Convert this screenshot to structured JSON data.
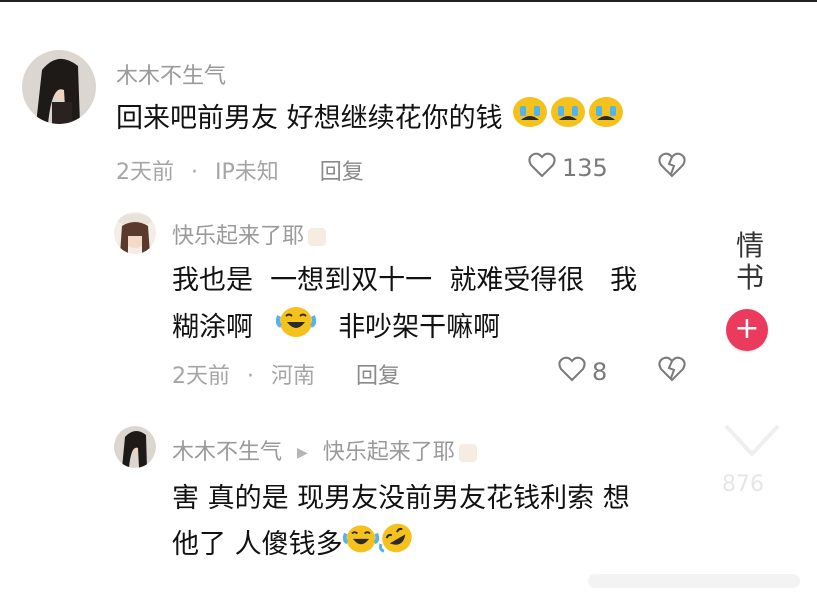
{
  "comments": [
    {
      "username": "木木不生气",
      "text": "回来吧前男友 好想继续花你的钱",
      "time": "2天前",
      "location": "IP未知",
      "reply_label": "回复",
      "likes": "135"
    },
    {
      "username": "快乐起来了耶",
      "text_line1": "我也是  一想到双十一  就难受得很   我",
      "text_line2a": "糊涂啊",
      "text_line2b": "非吵架干嘛啊",
      "time": "2天前",
      "location": "河南",
      "reply_label": "回复",
      "likes": "8"
    },
    {
      "username": "木木不生气",
      "reply_to": "快乐起来了耶",
      "text_line1": "害 真的是 现男友没前男友花钱利索 想",
      "text_line2": "他了 人傻钱多"
    }
  ],
  "side": {
    "logo": "情书",
    "plus": "+",
    "count": "876"
  },
  "colors": {
    "accent": "#ea3a5d",
    "meta": "#a5a5a5",
    "text": "#111111"
  },
  "icons": [
    "heart-icon",
    "broken-heart-icon",
    "crying-face-emoji",
    "laughing-tears-emoji",
    "rolling-laugh-emoji",
    "reply-arrow-icon",
    "plus-icon"
  ]
}
